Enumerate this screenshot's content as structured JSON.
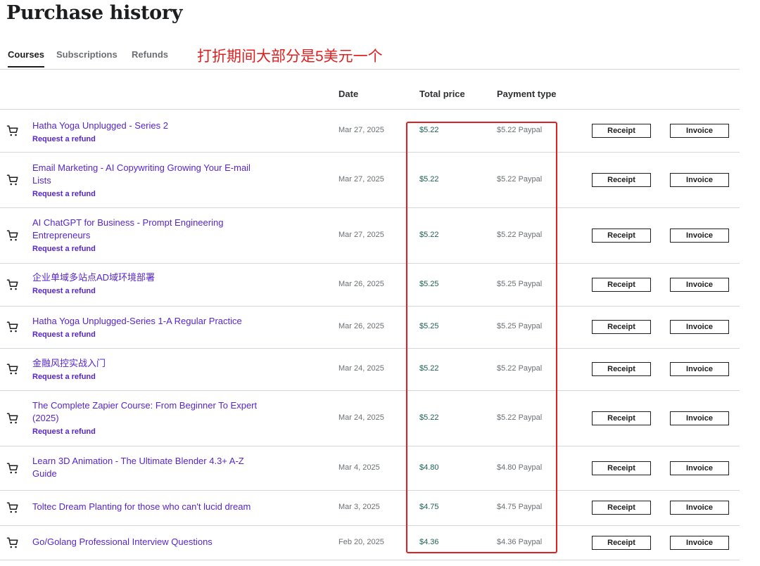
{
  "page": {
    "title": "Purchase history"
  },
  "tabs": [
    {
      "label": "Courses",
      "active": true
    },
    {
      "label": "Subscriptions",
      "active": false
    },
    {
      "label": "Refunds",
      "active": false
    }
  ],
  "annotation": {
    "text": "打折期间大部分是5美元一个",
    "color": "#e02020"
  },
  "table": {
    "headers": {
      "date": "Date",
      "total_price": "Total price",
      "payment_type": "Payment type"
    },
    "rows": [
      {
        "title": "Hatha Yoga Unplugged - Series 2",
        "refund": "Request a refund",
        "date": "Mar 27, 2025",
        "price": "$5.22",
        "payment": "$5.22 Paypal",
        "receipt": "Receipt",
        "invoice": "Invoice"
      },
      {
        "title": "Email Marketing - AI Copywriting Growing Your E-mail Lists",
        "refund": "Request a refund",
        "date": "Mar 27, 2025",
        "price": "$5.22",
        "payment": "$5.22 Paypal",
        "receipt": "Receipt",
        "invoice": "Invoice"
      },
      {
        "title": "AI ChatGPT for Business - Prompt Engineering Entrepreneurs",
        "refund": "Request a refund",
        "date": "Mar 27, 2025",
        "price": "$5.22",
        "payment": "$5.22 Paypal",
        "receipt": "Receipt",
        "invoice": "Invoice"
      },
      {
        "title": "企业单域多站点AD域环境部署",
        "refund": "Request a refund",
        "date": "Mar 26, 2025",
        "price": "$5.25",
        "payment": "$5.25 Paypal",
        "receipt": "Receipt",
        "invoice": "Invoice"
      },
      {
        "title": "Hatha Yoga Unplugged-Series 1-A Regular Practice",
        "refund": "Request a refund",
        "date": "Mar 26, 2025",
        "price": "$5.25",
        "payment": "$5.25 Paypal",
        "receipt": "Receipt",
        "invoice": "Invoice"
      },
      {
        "title": "金融风控实战入门",
        "refund": "Request a refund",
        "date": "Mar 24, 2025",
        "price": "$5.22",
        "payment": "$5.22 Paypal",
        "receipt": "Receipt",
        "invoice": "Invoice"
      },
      {
        "title": "The Complete Zapier Course: From Beginner To Expert (2025)",
        "refund": "Request a refund",
        "date": "Mar 24, 2025",
        "price": "$5.22",
        "payment": "$5.22 Paypal",
        "receipt": "Receipt",
        "invoice": "Invoice"
      },
      {
        "title": "Learn 3D Animation - The Ultimate Blender 4.3+ A-Z Guide",
        "refund": "",
        "date": "Mar 4, 2025",
        "price": "$4.80",
        "payment": "$4.80 Paypal",
        "receipt": "Receipt",
        "invoice": "Invoice"
      },
      {
        "title": "Toltec Dream Planting for those who can't lucid dream",
        "refund": "",
        "date": "Mar 3, 2025",
        "price": "$4.75",
        "payment": "$4.75 Paypal",
        "receipt": "Receipt",
        "invoice": "Invoice"
      },
      {
        "title": "Go/Golang Professional Interview Questions",
        "refund": "",
        "date": "Feb 20, 2025",
        "price": "$4.36",
        "payment": "$4.36 Paypal",
        "receipt": "Receipt",
        "invoice": "Invoice"
      }
    ]
  },
  "icons": {
    "row_icon": "shopping-cart-icon"
  },
  "colors": {
    "link": "#5624d0",
    "price": "#1e6055",
    "highlight": "#e02020"
  }
}
